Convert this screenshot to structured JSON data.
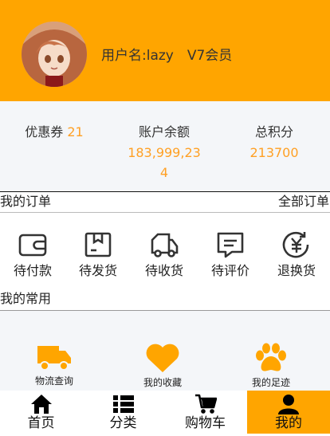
{
  "colors": {
    "accent": "#ffa500",
    "value": "#ffa024",
    "panel": "#f4f6f9"
  },
  "user": {
    "name": "用户名:lazy",
    "level": "V7会员",
    "avatar_icon": "anime-avatar"
  },
  "stats": {
    "coupon_label": "优惠券",
    "coupon_value": "21",
    "balance_label": "账户余额",
    "balance_value": "183,999,234",
    "points_label": "总积分",
    "points_value": "213700"
  },
  "orders": {
    "title": "我的订单",
    "all_link": "全部订单",
    "items": [
      {
        "label": "待付款",
        "icon": "wallet-icon"
      },
      {
        "label": "待发货",
        "icon": "package-icon"
      },
      {
        "label": "待收货",
        "icon": "truck-icon"
      },
      {
        "label": "待评价",
        "icon": "message-icon"
      },
      {
        "label": "退换货",
        "icon": "refund-icon"
      }
    ]
  },
  "common": {
    "title": "我的常用",
    "items": [
      {
        "label": "物流查询",
        "icon": "truck-icon"
      },
      {
        "label": "我的收藏",
        "icon": "heart-icon"
      },
      {
        "label": "我的足迹",
        "icon": "paw-icon"
      }
    ]
  },
  "tabs": [
    {
      "label": "首页",
      "icon": "home-icon"
    },
    {
      "label": "分类",
      "icon": "list-icon"
    },
    {
      "label": "购物车",
      "icon": "cart-icon"
    },
    {
      "label": "我的",
      "icon": "user-icon",
      "active": true
    }
  ]
}
